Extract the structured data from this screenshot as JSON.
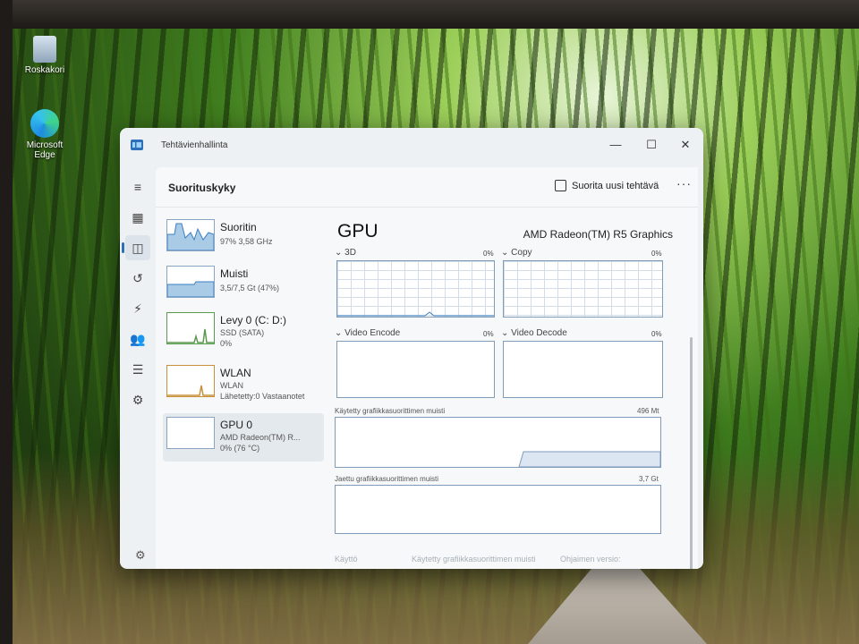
{
  "desktop": {
    "icons": [
      {
        "label": "Roskakori",
        "icon": "recycle-bin-icon"
      },
      {
        "label": "Microsoft Edge",
        "icon": "edge-icon"
      }
    ]
  },
  "window": {
    "title": "Tehtävienhallinta",
    "controls": {
      "minimize": "—",
      "maximize": "☐",
      "close": "✕"
    }
  },
  "nav": {
    "icons": [
      "hamburger-icon",
      "processes-icon",
      "performance-icon",
      "app-history-icon",
      "startup-icon",
      "users-icon",
      "details-icon",
      "services-icon"
    ],
    "active": "performance-icon"
  },
  "header": {
    "title": "Suorituskyky",
    "run_task": "Suorita uusi tehtävä",
    "more": "···"
  },
  "resources": [
    {
      "name": "Suoritin",
      "line1": "97% 3,58 GHz",
      "line2": ""
    },
    {
      "name": "Muisti",
      "line1": "3,5/7,5 Gt (47%)",
      "line2": ""
    },
    {
      "name": "Levy 0 (C: D:)",
      "line1": "SSD (SATA)",
      "line2": "0%"
    },
    {
      "name": "WLAN",
      "line1": "WLAN",
      "line2": "Lähetetty:0 Vastaanotet"
    },
    {
      "name": "GPU 0",
      "line1": "AMD Radeon(TM) R...",
      "line2": "0% (76 °C)"
    }
  ],
  "gpu": {
    "title": "GPU",
    "model": "AMD Radeon(TM) R5 Graphics",
    "engines": [
      {
        "label": "⌄ 3D",
        "pct": "0%"
      },
      {
        "label": "⌄ Copy",
        "pct": "0%"
      },
      {
        "label": "⌄ Video Encode",
        "pct": "0%"
      },
      {
        "label": "⌄ Video Decode",
        "pct": "0%"
      }
    ],
    "dedicated_memory": {
      "label": "Käytetty grafiikkasuorittimen muisti",
      "value": "496 Mt"
    },
    "shared_memory": {
      "label": "Jaettu grafiikkasuorittimen muisti",
      "value": "3,7 Gt"
    },
    "bottom": {
      "util": "Käyttö",
      "dedicated": "Käytetty grafiikkasuorittimen muisti",
      "driver": "Ohjaimen versio:"
    }
  }
}
